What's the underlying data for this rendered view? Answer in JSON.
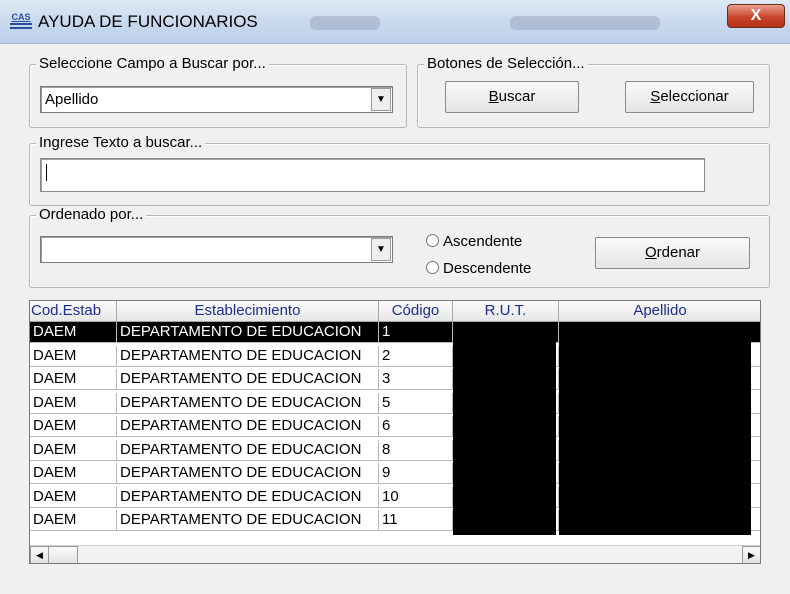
{
  "window": {
    "title": "AYUDA DE FUNCIONARIOS",
    "icon": "cas-app-icon",
    "icon_text": "CAS",
    "close_label": "X"
  },
  "search_field_group": {
    "legend": "Seleccione Campo a Buscar por...",
    "selected": "Apellido"
  },
  "selection_buttons": {
    "legend": "Botones de Selección...",
    "buscar": {
      "mnemonic": "B",
      "rest": "uscar"
    },
    "seleccionar": {
      "mnemonic": "S",
      "rest": "eleccionar"
    }
  },
  "search_text": {
    "legend": "Ingrese Texto a buscar...",
    "value": ""
  },
  "order_group": {
    "legend": "Ordenado por...",
    "selected": "",
    "ascending_label": "Ascendente",
    "descending_label": "Descendente",
    "ordenar": {
      "mnemonic": "O",
      "rest": "rdenar"
    }
  },
  "grid": {
    "columns": [
      "Cod.Estab",
      "Establecimiento",
      "Código",
      "R.U.T.",
      "Apellido"
    ],
    "rows": [
      {
        "cod": "DAEM",
        "establecimiento": "DEPARTAMENTO DE EDUCACION",
        "codigo": "1"
      },
      {
        "cod": "DAEM",
        "establecimiento": "DEPARTAMENTO DE EDUCACION",
        "codigo": "2"
      },
      {
        "cod": "DAEM",
        "establecimiento": "DEPARTAMENTO DE EDUCACION",
        "codigo": "3"
      },
      {
        "cod": "DAEM",
        "establecimiento": "DEPARTAMENTO DE EDUCACION",
        "codigo": "5"
      },
      {
        "cod": "DAEM",
        "establecimiento": "DEPARTAMENTO DE EDUCACION",
        "codigo": "6"
      },
      {
        "cod": "DAEM",
        "establecimiento": "DEPARTAMENTO DE EDUCACION",
        "codigo": "8"
      },
      {
        "cod": "DAEM",
        "establecimiento": "DEPARTAMENTO DE EDUCACION",
        "codigo": "9"
      },
      {
        "cod": "DAEM",
        "establecimiento": "DEPARTAMENTO DE EDUCACION",
        "codigo": "10"
      },
      {
        "cod": "DAEM",
        "establecimiento": "DEPARTAMENTO DE EDUCACION",
        "codigo": "11"
      }
    ],
    "selected_row_index": 0
  },
  "colors": {
    "header_text": "#1e2e8c",
    "selection": "#000000",
    "close_button": "#c8442a"
  }
}
